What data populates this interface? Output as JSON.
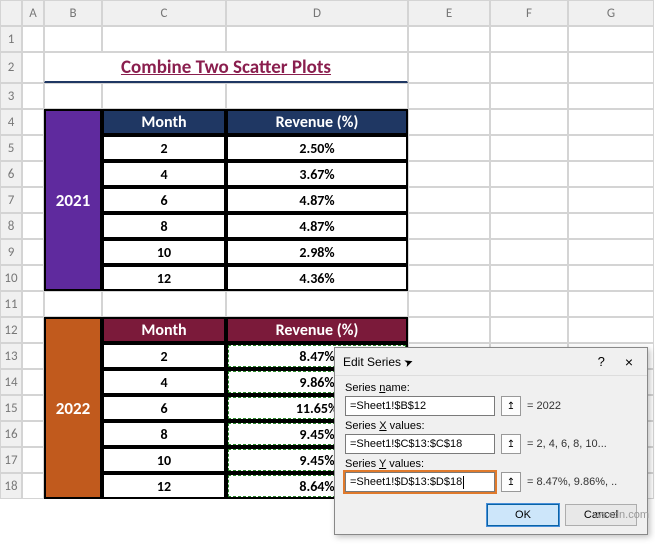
{
  "columns": {
    "A": "A",
    "B": "B",
    "C": "C",
    "D": "D",
    "E": "E",
    "F": "F",
    "G": "G"
  },
  "rows": [
    "1",
    "2",
    "3",
    "4",
    "5",
    "6",
    "7",
    "8",
    "9",
    "10",
    "11",
    "12",
    "13",
    "14",
    "15",
    "16",
    "17",
    "18"
  ],
  "title": "Combine Two Scatter Plots",
  "table1": {
    "year": "2021",
    "hdr_month": "Month",
    "hdr_rev": "Revenue (%)",
    "rows": [
      {
        "m": "2",
        "r": "2.50%"
      },
      {
        "m": "4",
        "r": "3.67%"
      },
      {
        "m": "6",
        "r": "4.87%"
      },
      {
        "m": "8",
        "r": "4.87%"
      },
      {
        "m": "10",
        "r": "2.98%"
      },
      {
        "m": "12",
        "r": "4.36%"
      }
    ]
  },
  "table2": {
    "year": "2022",
    "hdr_month": "Month",
    "hdr_rev": "Revenue (%)",
    "rows": [
      {
        "m": "2",
        "r": "8.47%"
      },
      {
        "m": "4",
        "r": "9.86%"
      },
      {
        "m": "6",
        "r": "11.65%"
      },
      {
        "m": "8",
        "r": "9.45%"
      },
      {
        "m": "10",
        "r": "9.45%"
      },
      {
        "m": "12",
        "r": "8.64%"
      }
    ]
  },
  "dialog": {
    "title": "Edit Series",
    "series_name_label": "Series name:",
    "series_name_value": "=Sheet1!$B$12",
    "series_name_preview": "= 2022",
    "series_x_label": "Series X values:",
    "series_x_value": "=Sheet1!$C$13:$C$18",
    "series_x_preview": "= 2, 4, 6, 8, 10...",
    "series_y_label": "Series Y values:",
    "series_y_value": "=Sheet1!$D$13:$D$18",
    "series_y_preview": "= 8.47%, 9.86%, ..",
    "ok": "OK",
    "cancel": "Cancel",
    "help": "?",
    "close": "×"
  },
  "watermark": "wsxdn.com",
  "chart_data": {
    "type": "scatter",
    "title": "Combine Two Scatter Plots",
    "xlabel": "Month",
    "ylabel": "Revenue (%)",
    "x": [
      2,
      4,
      6,
      8,
      10,
      12
    ],
    "series": [
      {
        "name": "2021",
        "values": [
          2.5,
          3.67,
          4.87,
          4.87,
          2.98,
          4.36
        ]
      },
      {
        "name": "2022",
        "values": [
          8.47,
          9.86,
          11.65,
          9.45,
          9.45,
          8.64
        ]
      }
    ]
  }
}
